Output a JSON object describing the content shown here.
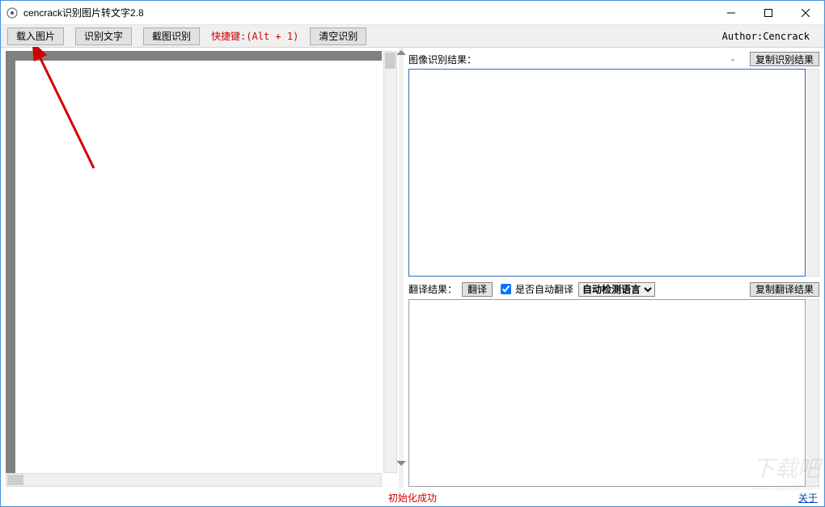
{
  "window": {
    "title": "cencrack识别图片转文字2.8"
  },
  "toolbar": {
    "load_image": "载入图片",
    "recognize_text": "识别文字",
    "screenshot_recognize": "截图识别",
    "hotkey": "快捷键:(Alt + 1)",
    "clear": "清空识别",
    "author": "Author:Cencrack"
  },
  "recognition": {
    "label": "图像识别结果：",
    "dash": "-",
    "copy_btn": "复制识别结果",
    "value": ""
  },
  "translation": {
    "label": "翻译结果：",
    "translate_btn": "翻译",
    "auto_checkbox": "是否自动翻译",
    "auto_checked": true,
    "lang_options": [
      "自动检测语言"
    ],
    "lang_selected": "自动检测语言",
    "copy_btn": "复制翻译结果",
    "value": ""
  },
  "status": {
    "message": "初始化成功",
    "about": "关于"
  },
  "watermark": "下载吧",
  "watermark_url": "www.xiazaiba.com"
}
